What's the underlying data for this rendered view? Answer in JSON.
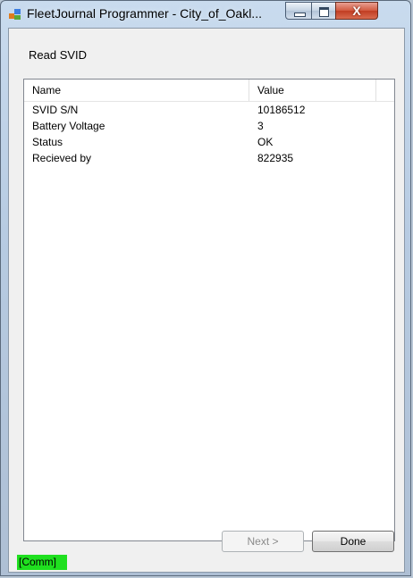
{
  "window": {
    "title": "FleetJournal Programmer - City_of_Oakl...",
    "caption_buttons": {
      "minimize": "minimize-icon",
      "maximize": "maximize-icon",
      "close": "close-icon",
      "close_glyph": "X"
    }
  },
  "heading": "Read SVID",
  "list": {
    "columns": [
      "Name",
      "Value"
    ],
    "rows": [
      {
        "name": "SVID S/N",
        "value": "10186512"
      },
      {
        "name": "Battery Voltage",
        "value": "3"
      },
      {
        "name": "Status",
        "value": "OK"
      },
      {
        "name": "Recieved by",
        "value": "822935"
      }
    ]
  },
  "buttons": {
    "next": "Next >",
    "done": "Done"
  },
  "status": {
    "comm": "[Comm]",
    "color": "#1fe01f"
  },
  "colors": {
    "title_bar": "#b7cbe2",
    "close_button": "#c13d22",
    "client_bg": "#f0f0f0"
  }
}
